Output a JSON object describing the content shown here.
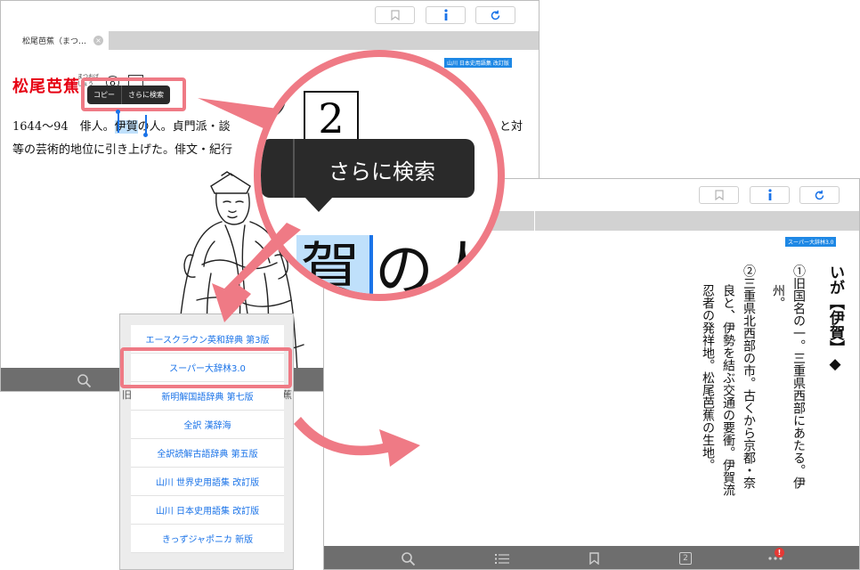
{
  "left_screen": {
    "tab_label": "松尾芭蕉（まつ…",
    "tab_close": "×",
    "dict_label": "山川 日本史用語集 改訂版",
    "headword": "松尾芭蕉",
    "reading_line1": "まつおば",
    "reading_line2": "しょう",
    "circle_number": "8",
    "box_number": "",
    "callout": {
      "copy": "コピー",
      "search_more": "さらに検索"
    },
    "body": {
      "line1_a": "1644〜94　俳人。",
      "line1_sel": "伊賀",
      "line1_b": "の人。貞門派・談",
      "line1_tail": "と対",
      "line2": "等の芸術的地位に引き上げた。俳文・紀行"
    }
  },
  "magnifier": {
    "circle_number": "",
    "box_number": "2",
    "callout_label": "さらに検索",
    "sel_char": "賀",
    "after_chars": "の人"
  },
  "picker": {
    "items": [
      "エースクラウン英和辞典 第3版",
      "スーパー大辞林3.0",
      "新明解国語辞典 第七版",
      "全訳 漢辞海",
      "全訳読解古語辞典 第五版",
      "山川 世界史用語集 改訂版",
      "山川 日本史用語集 改訂版",
      "きっずジャポニカ 新版"
    ],
    "behind_left": "旧",
    "behind_right": "蕉"
  },
  "right_screen": {
    "dict_label": "スーパー大辞林3.0",
    "tab_fragment": "]",
    "heading": "いが【伊賀】◆",
    "line1": "①旧国名の一。三重県西部にあたる。伊",
    "line2": "州。",
    "line3": "②三重県北西部の市。古くから京都・奈",
    "line4": "良と、伊勢を結ぶ交通の要衝。伊賀流",
    "line5": "忍者の発祥地。松尾芭蕉の生地。",
    "page_badge": "2",
    "notification": "!"
  },
  "colors": {
    "highlight_pink": "#ef7a85",
    "headword_red": "#e60012",
    "link_blue": "#1a73e8",
    "label_blue": "#1e88e5",
    "toolbar_gray": "#6e6e6e"
  }
}
